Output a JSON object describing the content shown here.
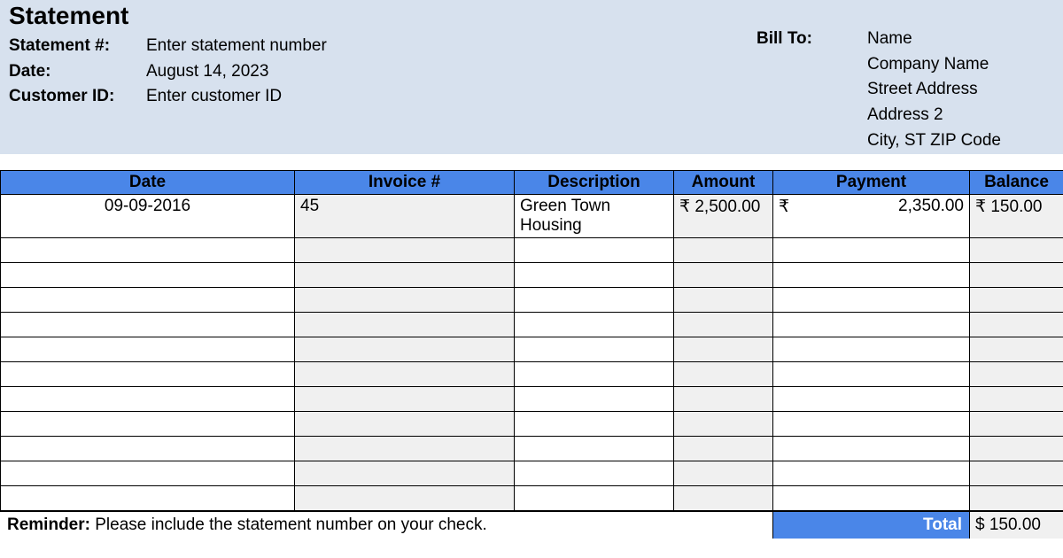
{
  "title": "Statement",
  "meta": {
    "statement_num_label": "Statement #:",
    "statement_num_value": "Enter statement number",
    "date_label": "Date:",
    "date_value": "August 14, 2023",
    "customer_id_label": "Customer ID:",
    "customer_id_value": "Enter customer ID"
  },
  "bill_to": {
    "label": "Bill To:",
    "name": "Name",
    "company": "Company Name",
    "street": "Street Address",
    "address2": "Address 2",
    "citystzip": "City, ST  ZIP Code"
  },
  "columns": {
    "date": "Date",
    "invoice": "Invoice #",
    "description": "Description",
    "amount": "Amount",
    "payment": "Payment",
    "balance": "Balance"
  },
  "rows": [
    {
      "date": "09-09-2016",
      "invoice": "45",
      "description": "Green Town Housing",
      "amount": "₹ 2,500.00",
      "payment_symbol": "₹",
      "payment_value": "2,350.00",
      "balance": "₹ 150.00"
    }
  ],
  "reminder_bold": "Reminder:",
  "reminder_text": " Please include the statement number on your check.",
  "total_label": "Total",
  "total_value": "$ 150.00"
}
